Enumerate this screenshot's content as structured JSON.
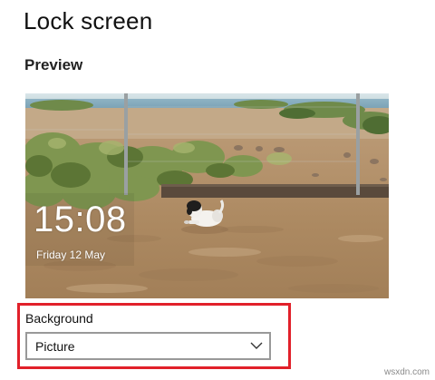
{
  "page": {
    "title": "Lock screen"
  },
  "preview": {
    "section_title": "Preview",
    "time": "15:08",
    "date": "Friday 12 May"
  },
  "background": {
    "label": "Background",
    "selected_value": "Picture",
    "highlight_color": "#e1202a"
  },
  "icons": {
    "dropdown": "chevron-down-icon"
  },
  "watermark": {
    "text": "wsxdn.com"
  }
}
